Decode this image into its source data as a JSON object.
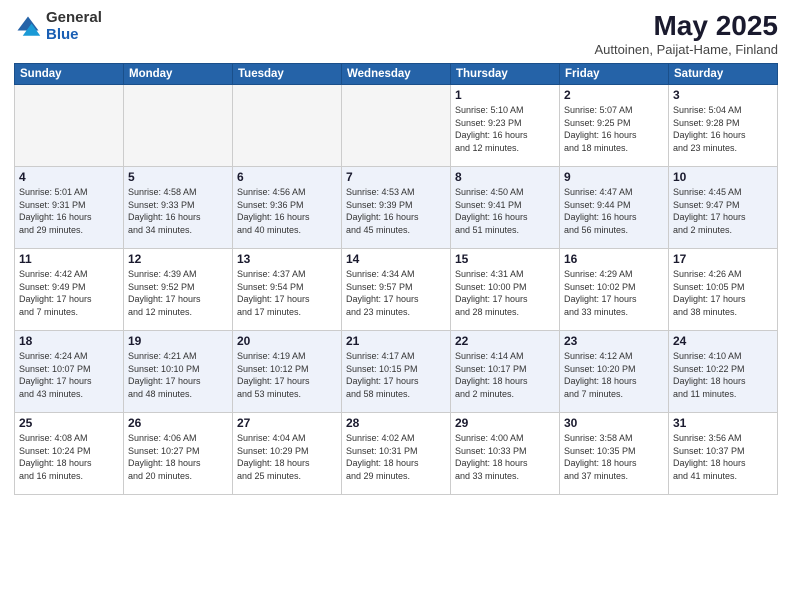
{
  "logo": {
    "general": "General",
    "blue": "Blue"
  },
  "title": "May 2025",
  "subtitle": "Auttoinen, Paijat-Hame, Finland",
  "weekdays": [
    "Sunday",
    "Monday",
    "Tuesday",
    "Wednesday",
    "Thursday",
    "Friday",
    "Saturday"
  ],
  "weeks": [
    [
      {
        "day": "",
        "info": ""
      },
      {
        "day": "",
        "info": ""
      },
      {
        "day": "",
        "info": ""
      },
      {
        "day": "",
        "info": ""
      },
      {
        "day": "1",
        "info": "Sunrise: 5:10 AM\nSunset: 9:23 PM\nDaylight: 16 hours\nand 12 minutes."
      },
      {
        "day": "2",
        "info": "Sunrise: 5:07 AM\nSunset: 9:25 PM\nDaylight: 16 hours\nand 18 minutes."
      },
      {
        "day": "3",
        "info": "Sunrise: 5:04 AM\nSunset: 9:28 PM\nDaylight: 16 hours\nand 23 minutes."
      }
    ],
    [
      {
        "day": "4",
        "info": "Sunrise: 5:01 AM\nSunset: 9:31 PM\nDaylight: 16 hours\nand 29 minutes."
      },
      {
        "day": "5",
        "info": "Sunrise: 4:58 AM\nSunset: 9:33 PM\nDaylight: 16 hours\nand 34 minutes."
      },
      {
        "day": "6",
        "info": "Sunrise: 4:56 AM\nSunset: 9:36 PM\nDaylight: 16 hours\nand 40 minutes."
      },
      {
        "day": "7",
        "info": "Sunrise: 4:53 AM\nSunset: 9:39 PM\nDaylight: 16 hours\nand 45 minutes."
      },
      {
        "day": "8",
        "info": "Sunrise: 4:50 AM\nSunset: 9:41 PM\nDaylight: 16 hours\nand 51 minutes."
      },
      {
        "day": "9",
        "info": "Sunrise: 4:47 AM\nSunset: 9:44 PM\nDaylight: 16 hours\nand 56 minutes."
      },
      {
        "day": "10",
        "info": "Sunrise: 4:45 AM\nSunset: 9:47 PM\nDaylight: 17 hours\nand 2 minutes."
      }
    ],
    [
      {
        "day": "11",
        "info": "Sunrise: 4:42 AM\nSunset: 9:49 PM\nDaylight: 17 hours\nand 7 minutes."
      },
      {
        "day": "12",
        "info": "Sunrise: 4:39 AM\nSunset: 9:52 PM\nDaylight: 17 hours\nand 12 minutes."
      },
      {
        "day": "13",
        "info": "Sunrise: 4:37 AM\nSunset: 9:54 PM\nDaylight: 17 hours\nand 17 minutes."
      },
      {
        "day": "14",
        "info": "Sunrise: 4:34 AM\nSunset: 9:57 PM\nDaylight: 17 hours\nand 23 minutes."
      },
      {
        "day": "15",
        "info": "Sunrise: 4:31 AM\nSunset: 10:00 PM\nDaylight: 17 hours\nand 28 minutes."
      },
      {
        "day": "16",
        "info": "Sunrise: 4:29 AM\nSunset: 10:02 PM\nDaylight: 17 hours\nand 33 minutes."
      },
      {
        "day": "17",
        "info": "Sunrise: 4:26 AM\nSunset: 10:05 PM\nDaylight: 17 hours\nand 38 minutes."
      }
    ],
    [
      {
        "day": "18",
        "info": "Sunrise: 4:24 AM\nSunset: 10:07 PM\nDaylight: 17 hours\nand 43 minutes."
      },
      {
        "day": "19",
        "info": "Sunrise: 4:21 AM\nSunset: 10:10 PM\nDaylight: 17 hours\nand 48 minutes."
      },
      {
        "day": "20",
        "info": "Sunrise: 4:19 AM\nSunset: 10:12 PM\nDaylight: 17 hours\nand 53 minutes."
      },
      {
        "day": "21",
        "info": "Sunrise: 4:17 AM\nSunset: 10:15 PM\nDaylight: 17 hours\nand 58 minutes."
      },
      {
        "day": "22",
        "info": "Sunrise: 4:14 AM\nSunset: 10:17 PM\nDaylight: 18 hours\nand 2 minutes."
      },
      {
        "day": "23",
        "info": "Sunrise: 4:12 AM\nSunset: 10:20 PM\nDaylight: 18 hours\nand 7 minutes."
      },
      {
        "day": "24",
        "info": "Sunrise: 4:10 AM\nSunset: 10:22 PM\nDaylight: 18 hours\nand 11 minutes."
      }
    ],
    [
      {
        "day": "25",
        "info": "Sunrise: 4:08 AM\nSunset: 10:24 PM\nDaylight: 18 hours\nand 16 minutes."
      },
      {
        "day": "26",
        "info": "Sunrise: 4:06 AM\nSunset: 10:27 PM\nDaylight: 18 hours\nand 20 minutes."
      },
      {
        "day": "27",
        "info": "Sunrise: 4:04 AM\nSunset: 10:29 PM\nDaylight: 18 hours\nand 25 minutes."
      },
      {
        "day": "28",
        "info": "Sunrise: 4:02 AM\nSunset: 10:31 PM\nDaylight: 18 hours\nand 29 minutes."
      },
      {
        "day": "29",
        "info": "Sunrise: 4:00 AM\nSunset: 10:33 PM\nDaylight: 18 hours\nand 33 minutes."
      },
      {
        "day": "30",
        "info": "Sunrise: 3:58 AM\nSunset: 10:35 PM\nDaylight: 18 hours\nand 37 minutes."
      },
      {
        "day": "31",
        "info": "Sunrise: 3:56 AM\nSunset: 10:37 PM\nDaylight: 18 hours\nand 41 minutes."
      }
    ]
  ]
}
